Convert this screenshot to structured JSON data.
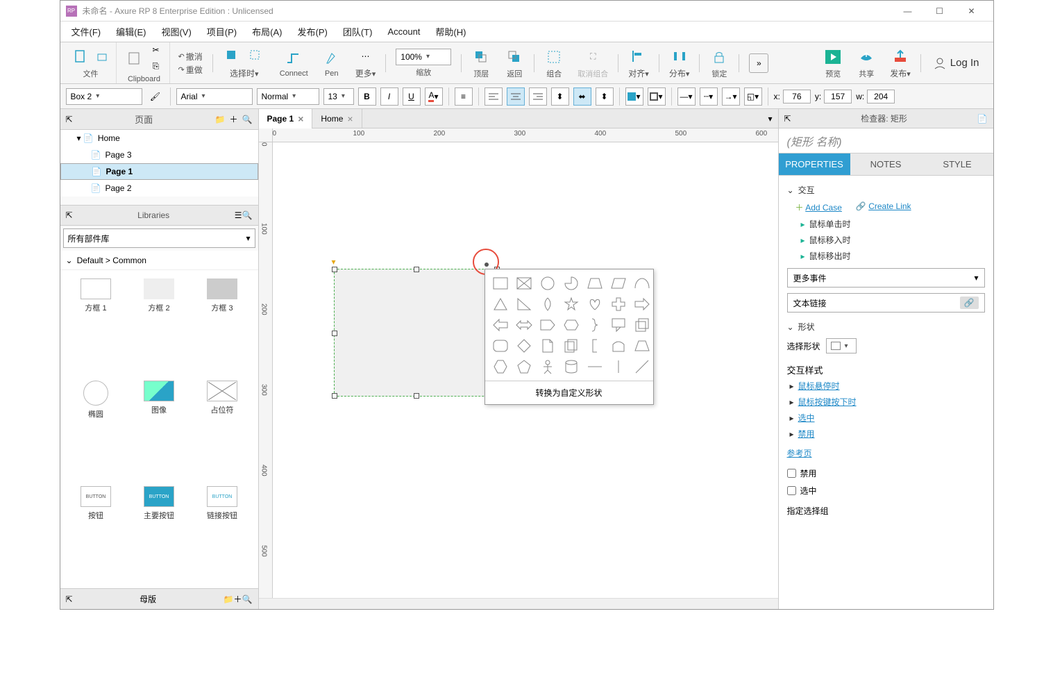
{
  "titlebar": {
    "title": "未命名 - Axure RP 8 Enterprise Edition : Unlicensed"
  },
  "menu": {
    "file": "文件(F)",
    "edit": "编辑(E)",
    "view": "视图(V)",
    "project": "项目(P)",
    "layout": "布局(A)",
    "publish": "发布(P)",
    "team": "团队(T)",
    "account": "Account",
    "help": "帮助(H)"
  },
  "tb": {
    "file": "文件",
    "clipboard": "Clipboard",
    "undo": "撤消",
    "redo": "重做",
    "selectmode": "选择时",
    "connect": "Connect",
    "pen": "Pen",
    "more": "更多",
    "zoom": "缩放",
    "zoomval": "100%",
    "front": "顶层",
    "back": "返回",
    "group": "组合",
    "ungroup": "取消组合",
    "align": "对齐",
    "distribute": "分布",
    "lock": "锁定",
    "preview": "预览",
    "share": "共享",
    "publish": "发布",
    "login": "Log In",
    "overflow": "»"
  },
  "tb2": {
    "shape": "Box 2",
    "font": "Arial",
    "weight": "Normal",
    "size": "13",
    "x_label": "x:",
    "x": "76",
    "y_label": "y:",
    "y": "157",
    "w_label": "w:",
    "w": "204"
  },
  "pages": {
    "title": "页面",
    "root": "Home",
    "p1": "Page 3",
    "p2": "Page 1",
    "p3": "Page 2"
  },
  "libs": {
    "title": "Libraries",
    "sel": "所有部件库",
    "cat": "Default > Common",
    "items": [
      "方框 1",
      "方框 2",
      "方框 3",
      "椭圆",
      "图像",
      "占位符",
      "BUTTON",
      "BUTTON",
      "BUTTON"
    ]
  },
  "masters": {
    "title": "母版"
  },
  "tabs": {
    "t1": "Page 1",
    "t2": "Home"
  },
  "ruler_h": [
    "0",
    "100",
    "200",
    "300",
    "400",
    "500",
    "600"
  ],
  "ruler_v": [
    "0",
    "100",
    "200",
    "300",
    "400",
    "500"
  ],
  "shapepopup": {
    "footer": "转换为自定义形状"
  },
  "inspector": {
    "title": "检查器: 矩形",
    "name": "(矩形 名称)",
    "tabs": {
      "props": "PROPERTIES",
      "notes": "NOTES",
      "style": "STYLE"
    },
    "inter_title": "交互",
    "addcase": "Add Case",
    "createlink": "Create Link",
    "events": [
      "鼠标单击时",
      "鼠标移入时",
      "鼠标移出时"
    ],
    "moreevents": "更多事件",
    "textlink": "文本链接",
    "shape_title": "形状",
    "selectshape": "选择形状",
    "istyle_title": "交互样式",
    "istyles": [
      "鼠标悬停时",
      "鼠标按键按下时",
      "选中",
      "禁用"
    ],
    "refpage": "参考页",
    "chk_disable": "禁用",
    "chk_select": "选中",
    "selgroup": "指定选择组"
  }
}
